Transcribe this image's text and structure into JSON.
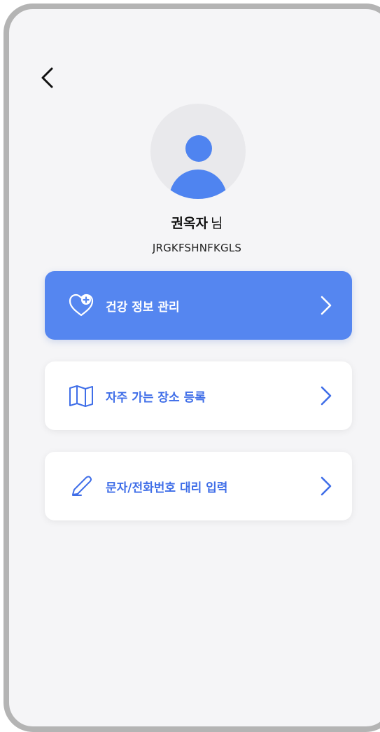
{
  "profile": {
    "name": "권옥자",
    "honorific": "님",
    "user_id": "JRGKFSHNFKGLS"
  },
  "menu": {
    "items": [
      {
        "label": "건강 정보 관리",
        "icon": "heart-plus-icon"
      },
      {
        "label": "자주 가는 장소 등록",
        "icon": "map-icon"
      },
      {
        "label": "문자/전화번호 대리 입력",
        "icon": "pencil-icon"
      }
    ]
  },
  "colors": {
    "accent": "#5586f0",
    "accent_text": "#3f6ee8",
    "background": "#f5f5f7",
    "avatar_bg": "#e9e9ec"
  },
  "icons": {
    "back": "chevron-left-icon",
    "avatar": "person-icon",
    "arrow": "chevron-right-icon"
  }
}
